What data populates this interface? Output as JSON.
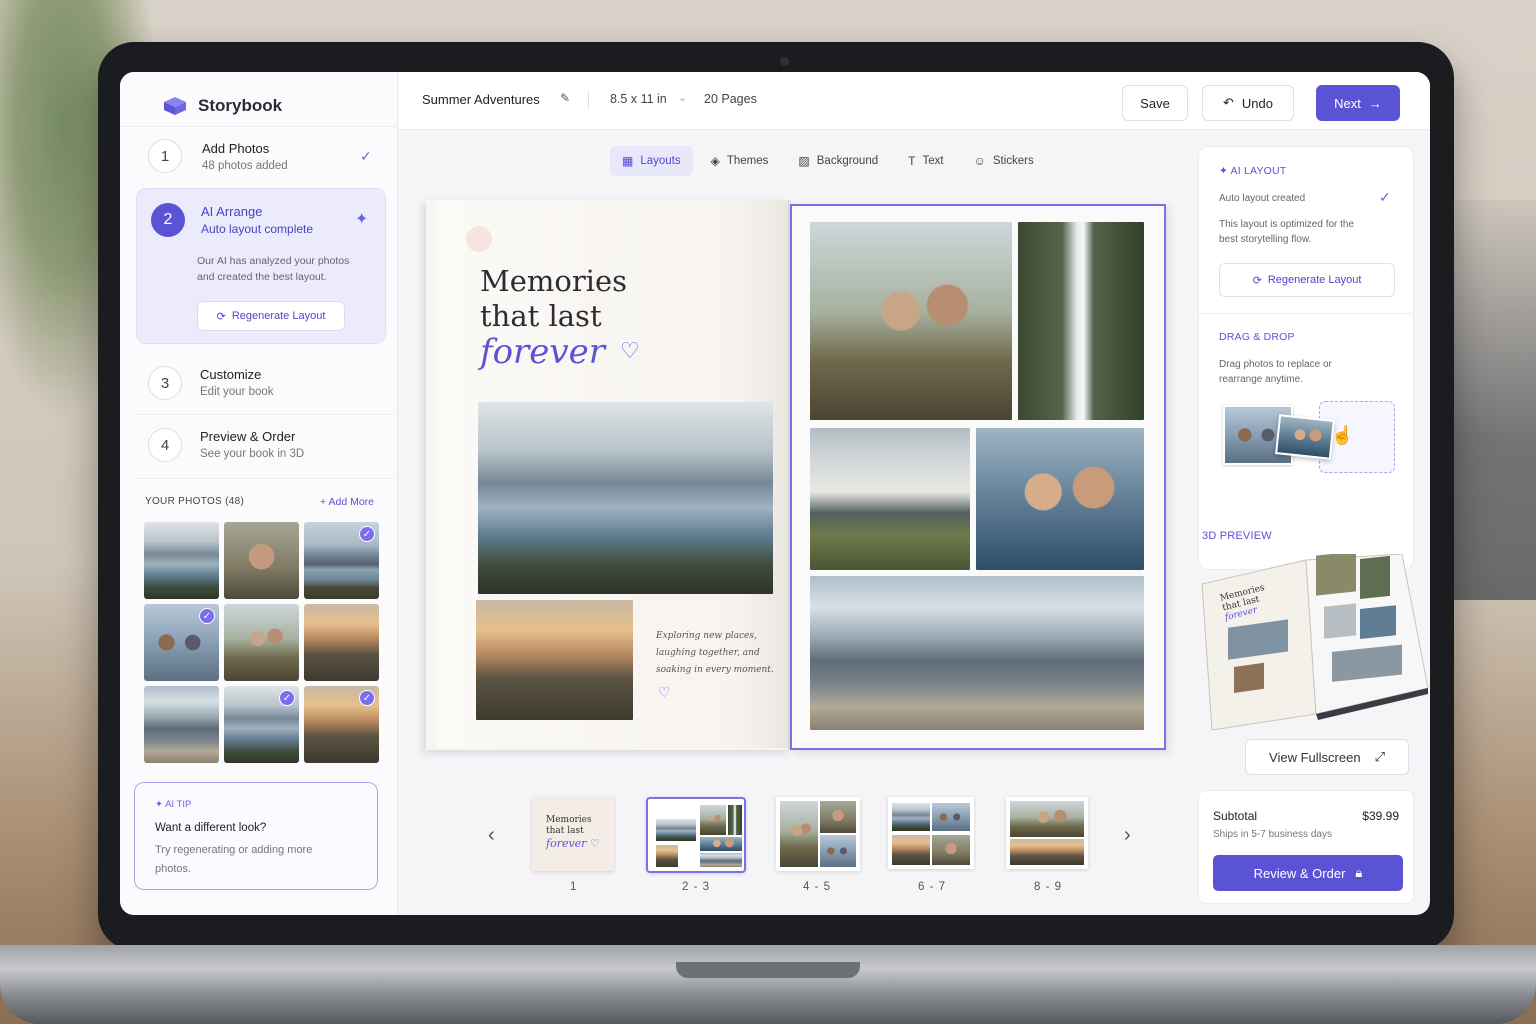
{
  "app": {
    "name": "Storybook"
  },
  "project": {
    "title": "Summer Adventures",
    "size": "8.5 x 11 in",
    "pages": "20 Pages"
  },
  "toolbar": {
    "save": "Save",
    "undo": "Undo",
    "next": "Next"
  },
  "steps": [
    {
      "num": "1",
      "title": "Add Photos",
      "sub": "48 photos added"
    },
    {
      "num": "2",
      "title": "AI Arrange",
      "sub": "Auto layout complete",
      "desc": "Our AI has analyzed your photos and created the best layout.",
      "button": "Regenerate Layout"
    },
    {
      "num": "3",
      "title": "Customize",
      "sub": "Edit your book"
    },
    {
      "num": "4",
      "title": "Preview & Order",
      "sub": "See your book in 3D"
    }
  ],
  "photos": {
    "heading": "YOUR PHOTOS (48)",
    "add_more": "+ Add More"
  },
  "tip": {
    "label": "AI TIP",
    "title": "Want a different look?",
    "body": "Try regenerating or adding more photos."
  },
  "tools": [
    {
      "label": "Layouts",
      "icon": "grid-icon"
    },
    {
      "label": "Themes",
      "icon": "palette-icon"
    },
    {
      "label": "Background",
      "icon": "background-icon"
    },
    {
      "label": "Text",
      "icon": "text-icon"
    },
    {
      "label": "Stickers",
      "icon": "sticker-icon"
    }
  ],
  "book": {
    "title_line1": "Memories",
    "title_line2": "that last",
    "script": "forever",
    "caption": "Exploring new places, laughing together, and soaking in every moment."
  },
  "page_strip": [
    "1",
    "2 - 3",
    "4 - 5",
    "6 - 7",
    "8 - 9"
  ],
  "ai_layout": {
    "label": "AI LAYOUT",
    "status": "Auto layout created",
    "desc": "This layout is optimized for the best storytelling flow.",
    "button": "Regenerate Layout"
  },
  "drag_drop": {
    "label": "DRAG & DROP",
    "desc": "Drag photos to replace or rearrange anytime."
  },
  "preview": {
    "label": "3D PREVIEW",
    "button": "View Fullscreen"
  },
  "order": {
    "subtotal_label": "Subtotal",
    "price": "$39.99",
    "shipping": "Ships in 5-7 business days",
    "button": "Review & Order"
  },
  "colors": {
    "accent": "#5b53d6",
    "accent_light": "#ecebfb"
  }
}
